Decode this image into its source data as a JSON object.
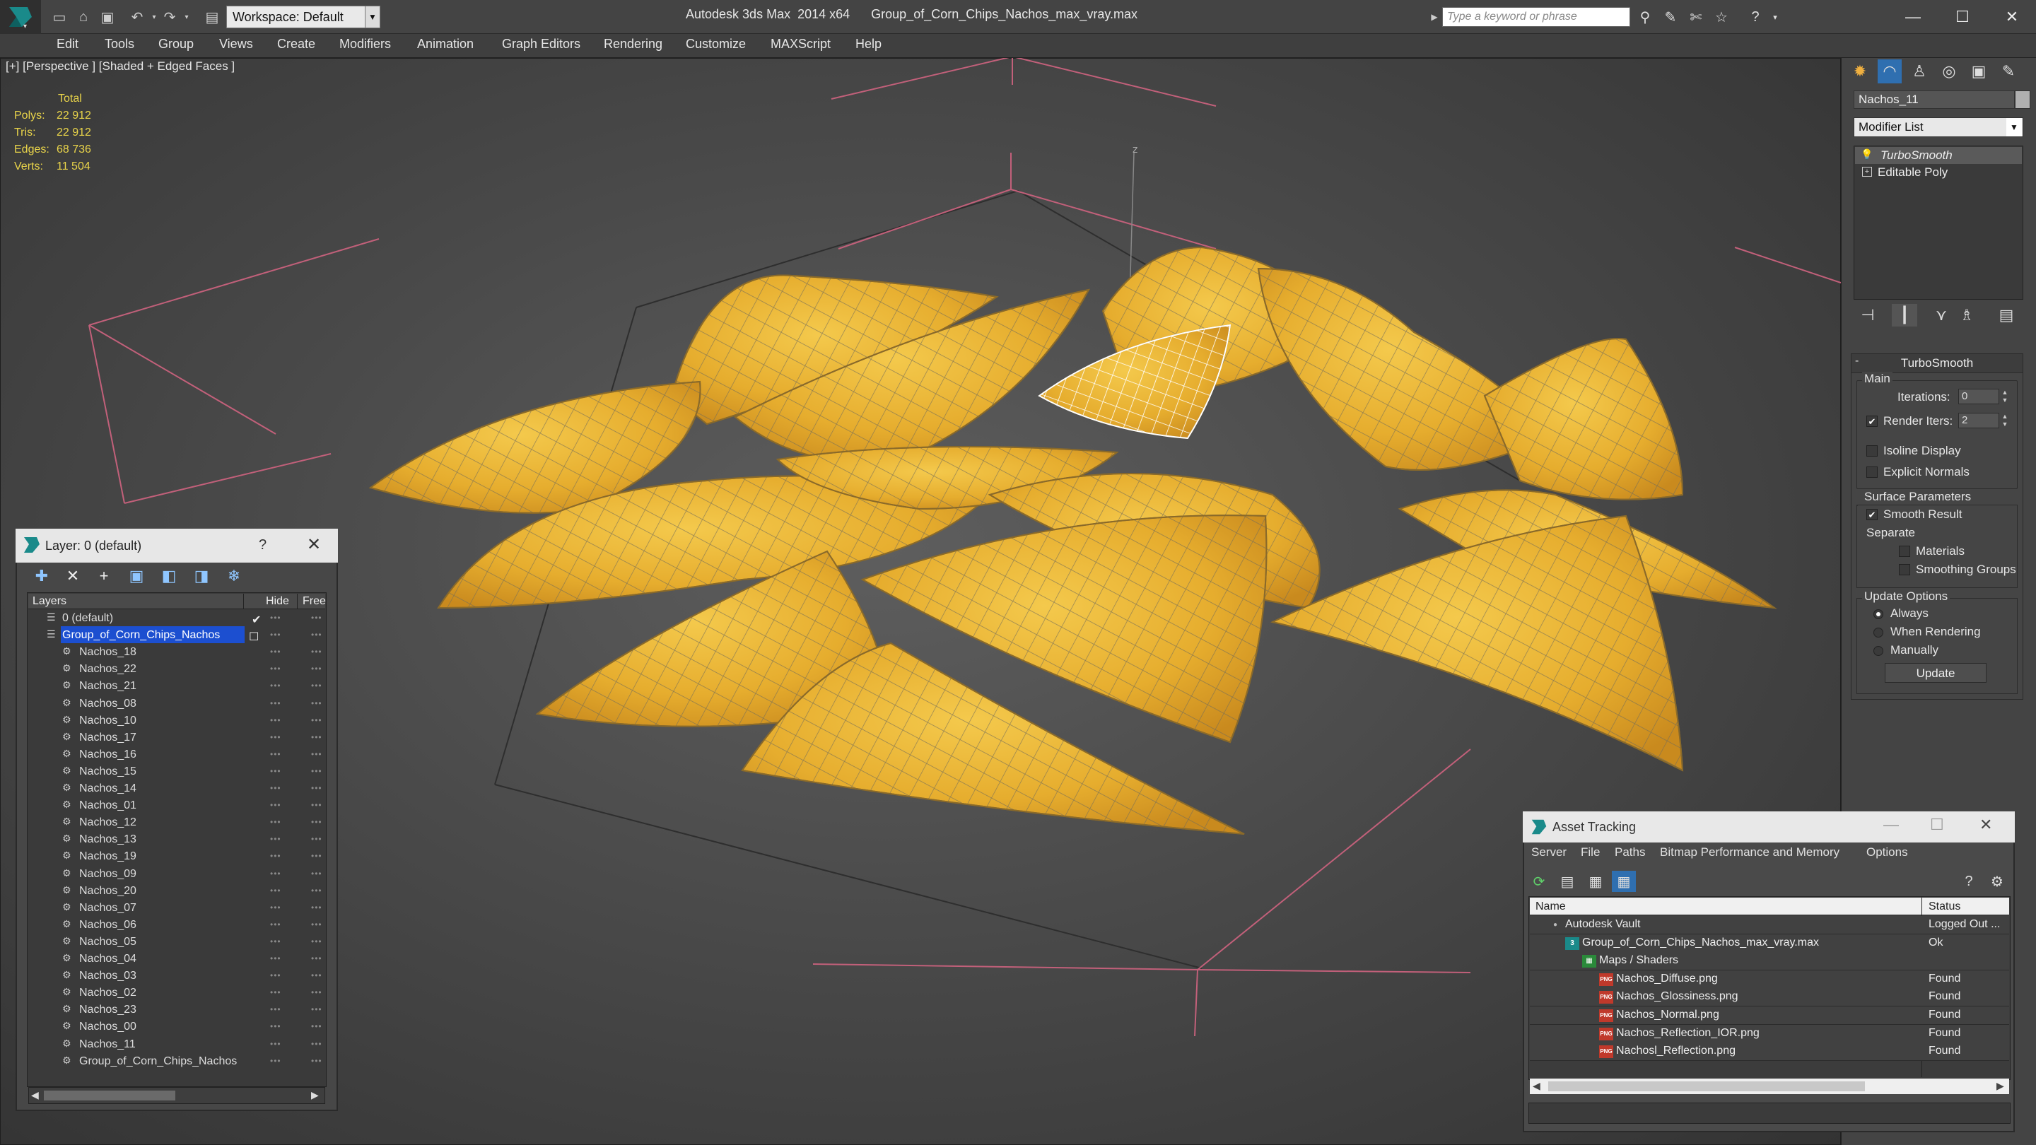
{
  "title_bar": {
    "app_title": "Autodesk 3ds Max  2014 x64      Group_of_Corn_Chips_Nachos_max_vray.max",
    "workspace": "Workspace: Default",
    "search_placeholder": "Type a keyword or phrase"
  },
  "menu": [
    "Edit",
    "Tools",
    "Group",
    "Views",
    "Create",
    "Modifiers",
    "Animation",
    "Graph Editors",
    "Rendering",
    "Customize",
    "MAXScript",
    "Help"
  ],
  "viewport": {
    "label": "[+] [Perspective ] [Shaded + Edged Faces ]",
    "stats": {
      "header": "Total",
      "rows": [
        {
          "label": "Polys:",
          "value": "22 912"
        },
        {
          "label": "Tris:",
          "value": "22 912"
        },
        {
          "label": "Edges:",
          "value": "68 736"
        },
        {
          "label": "Verts:",
          "value": "11 504"
        }
      ]
    },
    "axis_label": "z"
  },
  "command_panel": {
    "object_name": "Nachos_11",
    "modifier_list": "Modifier List",
    "stack": [
      "TurboSmooth",
      "Editable Poly"
    ],
    "turbosmooth": {
      "header": "TurboSmooth",
      "main_label": "Main",
      "iterations_label": "Iterations:",
      "iterations_value": "0",
      "render_iters_label": "Render Iters:",
      "render_iters_value": "2",
      "isoline_label": "Isoline Display",
      "explicit_normals_label": "Explicit Normals",
      "surface_params_label": "Surface Parameters",
      "smooth_result_label": "Smooth Result",
      "separate_label": "Separate",
      "materials_label": "Materials",
      "smoothing_groups_label": "Smoothing Groups",
      "update_options_label": "Update Options",
      "always_label": "Always",
      "when_rendering_label": "When Rendering",
      "manually_label": "Manually",
      "update_button": "Update"
    }
  },
  "layer_dialog": {
    "title": "Layer: 0 (default)",
    "help": "?",
    "columns": {
      "layers": "Layers",
      "hide": "Hide",
      "freeze": "Free"
    },
    "rows": [
      {
        "name": "0 (default)",
        "level": 0,
        "kind": "layer"
      },
      {
        "name": "Group_of_Corn_Chips_Nachos",
        "level": 0,
        "kind": "layer",
        "selected": true
      },
      {
        "name": "Nachos_18",
        "level": 1,
        "kind": "object"
      },
      {
        "name": "Nachos_22",
        "level": 1,
        "kind": "object"
      },
      {
        "name": "Nachos_21",
        "level": 1,
        "kind": "object"
      },
      {
        "name": "Nachos_08",
        "level": 1,
        "kind": "object"
      },
      {
        "name": "Nachos_10",
        "level": 1,
        "kind": "object"
      },
      {
        "name": "Nachos_17",
        "level": 1,
        "kind": "object"
      },
      {
        "name": "Nachos_16",
        "level": 1,
        "kind": "object"
      },
      {
        "name": "Nachos_15",
        "level": 1,
        "kind": "object"
      },
      {
        "name": "Nachos_14",
        "level": 1,
        "kind": "object"
      },
      {
        "name": "Nachos_01",
        "level": 1,
        "kind": "object"
      },
      {
        "name": "Nachos_12",
        "level": 1,
        "kind": "object"
      },
      {
        "name": "Nachos_13",
        "level": 1,
        "kind": "object"
      },
      {
        "name": "Nachos_19",
        "level": 1,
        "kind": "object"
      },
      {
        "name": "Nachos_09",
        "level": 1,
        "kind": "object"
      },
      {
        "name": "Nachos_20",
        "level": 1,
        "kind": "object"
      },
      {
        "name": "Nachos_07",
        "level": 1,
        "kind": "object"
      },
      {
        "name": "Nachos_06",
        "level": 1,
        "kind": "object"
      },
      {
        "name": "Nachos_05",
        "level": 1,
        "kind": "object"
      },
      {
        "name": "Nachos_04",
        "level": 1,
        "kind": "object"
      },
      {
        "name": "Nachos_03",
        "level": 1,
        "kind": "object"
      },
      {
        "name": "Nachos_02",
        "level": 1,
        "kind": "object"
      },
      {
        "name": "Nachos_23",
        "level": 1,
        "kind": "object"
      },
      {
        "name": "Nachos_00",
        "level": 1,
        "kind": "object"
      },
      {
        "name": "Nachos_11",
        "level": 1,
        "kind": "object"
      },
      {
        "name": "Group_of_Corn_Chips_Nachos",
        "level": 1,
        "kind": "object"
      }
    ]
  },
  "asset_tracking": {
    "title": "Asset Tracking",
    "menu": [
      "Server",
      "File",
      "Paths",
      "Bitmap Performance and Memory",
      "Options"
    ],
    "columns": {
      "name": "Name",
      "status": "Status"
    },
    "rows": [
      {
        "name": "Autodesk Vault",
        "status": "Logged Out ...",
        "level": 0,
        "icon": "vault"
      },
      {
        "name": "Group_of_Corn_Chips_Nachos_max_vray.max",
        "status": "Ok",
        "level": 1,
        "icon": "max"
      },
      {
        "name": "Maps / Shaders",
        "status": "",
        "level": 2,
        "icon": "maps"
      },
      {
        "name": "Nachos_Diffuse.png",
        "status": "Found",
        "level": 3,
        "icon": "png"
      },
      {
        "name": "Nachos_Glossiness.png",
        "status": "Found",
        "level": 3,
        "icon": "png"
      },
      {
        "name": "Nachos_Normal.png",
        "status": "Found",
        "level": 3,
        "icon": "png"
      },
      {
        "name": "Nachos_Reflection_IOR.png",
        "status": "Found",
        "level": 3,
        "icon": "png"
      },
      {
        "name": "Nachosl_Reflection.png",
        "status": "Found",
        "level": 3,
        "icon": "png"
      }
    ]
  },
  "colors": {
    "stats_yellow": "#e9d44a",
    "selection_blue": "#1c4fd0",
    "chip_yellow": "#e8b434",
    "grid_pink": "#c2607a"
  }
}
